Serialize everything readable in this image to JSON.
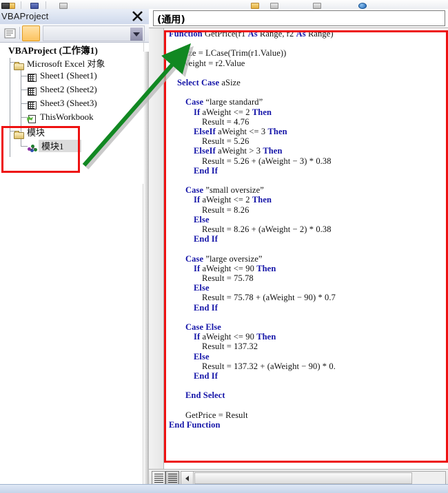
{
  "window": {
    "toolbar_icons": [
      "excel-workbook-icon",
      "vba-module-icon",
      "form-icon",
      "properties-icon",
      "help-icon"
    ]
  },
  "project_explorer": {
    "title": "VBAProject",
    "close_label": "×",
    "toolbar": {
      "view_code_icon": "view-code-icon",
      "toggle_folders_icon": "toggle-folders-icon",
      "dropdown_icon": "dropdown-icon"
    },
    "tree": [
      {
        "label": "VBAProject (工作簿1)",
        "icon": "project-icon",
        "depth": 0,
        "bold": true
      },
      {
        "label": "Microsoft Excel 对象",
        "icon": "folder-icon",
        "depth": 1,
        "bold": false
      },
      {
        "label": "Sheet1 (Sheet1)",
        "icon": "sheet-icon",
        "depth": 2,
        "bold": false
      },
      {
        "label": "Sheet2 (Sheet2)",
        "icon": "sheet-icon",
        "depth": 2,
        "bold": false
      },
      {
        "label": "Sheet3 (Sheet3)",
        "icon": "sheet-icon",
        "depth": 2,
        "bold": false
      },
      {
        "label": "ThisWorkbook",
        "icon": "workbook-icon",
        "depth": 2,
        "bold": false
      },
      {
        "label": "模块",
        "icon": "folder-icon",
        "depth": 1,
        "bold": false
      },
      {
        "label": "模块1",
        "icon": "module-icon",
        "depth": 2,
        "bold": false
      }
    ],
    "highlight_box_color": "#ee1111",
    "selected_item": "模块1"
  },
  "annotation": {
    "arrow_color": "#118822",
    "arrow_from": "模块1",
    "arrow_to": "code-window"
  },
  "code_window": {
    "object_combo_value": "(通用)",
    "highlight_box_color": "#ee1111",
    "lines": [
      {
        "indent": 0,
        "segments": [
          {
            "t": "Function",
            "k": true
          },
          {
            "t": " GetPrice(r1 ",
            "k": false
          },
          {
            "t": "As",
            "k": true
          },
          {
            "t": " Range, r2 ",
            "k": false
          },
          {
            "t": "As",
            "k": true
          },
          {
            "t": " Range)",
            "k": false
          }
        ]
      },
      {
        "indent": 0,
        "segments": []
      },
      {
        "indent": 2,
        "segments": [
          {
            "t": "aSize = LCase(Trim(r1.Value))",
            "k": false
          }
        ]
      },
      {
        "indent": 2,
        "segments": [
          {
            "t": "aWeight = r2.Value",
            "k": false
          }
        ]
      },
      {
        "indent": 0,
        "segments": []
      },
      {
        "indent": 2,
        "segments": [
          {
            "t": "Select Case",
            "k": true
          },
          {
            "t": " aSize",
            "k": false
          }
        ]
      },
      {
        "indent": 0,
        "segments": []
      },
      {
        "indent": 4,
        "segments": [
          {
            "t": "Case",
            "k": true
          },
          {
            "t": " “large standard”",
            "k": false
          }
        ]
      },
      {
        "indent": 6,
        "segments": [
          {
            "t": "If",
            "k": true
          },
          {
            "t": " aWeight <= 2 ",
            "k": false
          },
          {
            "t": "Then",
            "k": true
          }
        ]
      },
      {
        "indent": 8,
        "segments": [
          {
            "t": "Result = 4.76",
            "k": false
          }
        ]
      },
      {
        "indent": 6,
        "segments": [
          {
            "t": "ElseIf",
            "k": true
          },
          {
            "t": " aWeight <= 3 ",
            "k": false
          },
          {
            "t": "Then",
            "k": true
          }
        ]
      },
      {
        "indent": 8,
        "segments": [
          {
            "t": "Result = 5.26",
            "k": false
          }
        ]
      },
      {
        "indent": 6,
        "segments": [
          {
            "t": "ElseIf",
            "k": true
          },
          {
            "t": " aWeight > 3 ",
            "k": false
          },
          {
            "t": "Then",
            "k": true
          }
        ]
      },
      {
        "indent": 8,
        "segments": [
          {
            "t": "Result = 5.26 + (aWeight − 3) * 0.38",
            "k": false
          }
        ]
      },
      {
        "indent": 6,
        "segments": [
          {
            "t": "End If",
            "k": true
          }
        ]
      },
      {
        "indent": 0,
        "segments": []
      },
      {
        "indent": 4,
        "segments": [
          {
            "t": "Case",
            "k": true
          },
          {
            "t": " ”small oversize”",
            "k": false
          }
        ]
      },
      {
        "indent": 6,
        "segments": [
          {
            "t": "If",
            "k": true
          },
          {
            "t": " aWeight <= 2 ",
            "k": false
          },
          {
            "t": "Then",
            "k": true
          }
        ]
      },
      {
        "indent": 8,
        "segments": [
          {
            "t": "Result = 8.26",
            "k": false
          }
        ]
      },
      {
        "indent": 6,
        "segments": [
          {
            "t": "Else",
            "k": true
          }
        ]
      },
      {
        "indent": 8,
        "segments": [
          {
            "t": "Result = 8.26 + (aWeight − 2) * 0.38",
            "k": false
          }
        ]
      },
      {
        "indent": 6,
        "segments": [
          {
            "t": "End If",
            "k": true
          }
        ]
      },
      {
        "indent": 0,
        "segments": []
      },
      {
        "indent": 4,
        "segments": [
          {
            "t": "Case",
            "k": true
          },
          {
            "t": " ”large oversize”",
            "k": false
          }
        ]
      },
      {
        "indent": 6,
        "segments": [
          {
            "t": "If",
            "k": true
          },
          {
            "t": " aWeight <= 90 ",
            "k": false
          },
          {
            "t": "Then",
            "k": true
          }
        ]
      },
      {
        "indent": 8,
        "segments": [
          {
            "t": "Result = 75.78",
            "k": false
          }
        ]
      },
      {
        "indent": 6,
        "segments": [
          {
            "t": "Else",
            "k": true
          }
        ]
      },
      {
        "indent": 8,
        "segments": [
          {
            "t": "Result = 75.78 + (aWeight − 90) * 0.7",
            "k": false
          }
        ]
      },
      {
        "indent": 6,
        "segments": [
          {
            "t": "End If",
            "k": true
          }
        ]
      },
      {
        "indent": 0,
        "segments": []
      },
      {
        "indent": 4,
        "segments": [
          {
            "t": "Case Else",
            "k": true
          }
        ]
      },
      {
        "indent": 6,
        "segments": [
          {
            "t": "If",
            "k": true
          },
          {
            "t": " aWeight <= 90 ",
            "k": false
          },
          {
            "t": "Then",
            "k": true
          }
        ]
      },
      {
        "indent": 8,
        "segments": [
          {
            "t": "Result = 137.32",
            "k": false
          }
        ]
      },
      {
        "indent": 6,
        "segments": [
          {
            "t": "Else",
            "k": true
          }
        ]
      },
      {
        "indent": 8,
        "segments": [
          {
            "t": "Result = 137.32 + (aWeight − 90) * 0.",
            "k": false
          }
        ]
      },
      {
        "indent": 6,
        "segments": [
          {
            "t": "End If",
            "k": true
          }
        ]
      },
      {
        "indent": 0,
        "segments": []
      },
      {
        "indent": 4,
        "segments": [
          {
            "t": "End Select",
            "k": true
          }
        ]
      },
      {
        "indent": 0,
        "segments": []
      },
      {
        "indent": 4,
        "segments": [
          {
            "t": "GetPrice = Result",
            "k": false
          }
        ]
      },
      {
        "indent": 0,
        "segments": [
          {
            "t": "End Function",
            "k": true
          }
        ]
      }
    ],
    "bottom_bar": {
      "procedure_view_icon": "procedure-view-icon",
      "full_module_view_icon": "full-module-view-icon",
      "hscroll_left_icon": "scroll-left-icon"
    }
  }
}
